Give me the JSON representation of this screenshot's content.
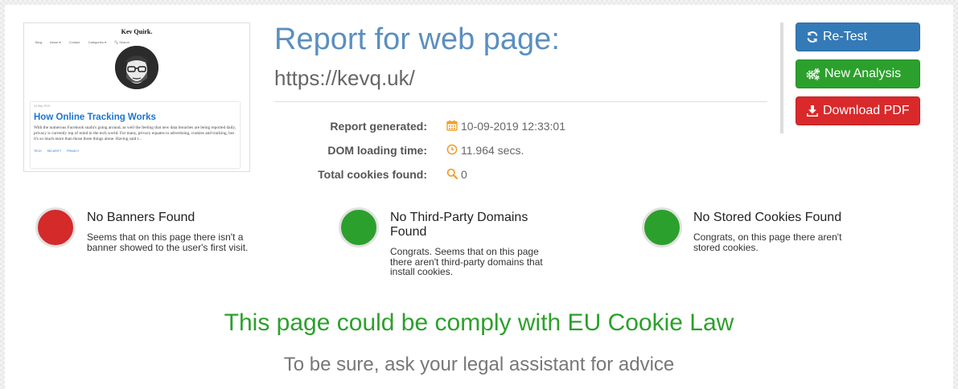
{
  "thumbnail": {
    "site_title": "Kev Quirk.",
    "nav": [
      "Blog",
      "About ▾",
      "Contact",
      "Categories ▾",
      "🔍 Search"
    ],
    "post_date": "10 Sep 2019",
    "post_title": "How Online Tracking Works",
    "post_text": "With the numerous Facebook snafu's going around, as well the feeling that new data breaches are being reported daily, privacy is currently top of mind in the tech world. For many, privacy equates to advertising, cookies and tracking, but it's so much more than those three things alone. Having said t...",
    "post_tags": [
      "TECH",
      "SECURITY",
      "PRIVACY"
    ]
  },
  "header": {
    "title": "Report for web page:",
    "url": "https://kevq.uk/"
  },
  "info": {
    "report_generated_label": "Report generated:",
    "report_generated_value": "10-09-2019 12:33:01",
    "dom_loading_label": "DOM loading time:",
    "dom_loading_value": "11.964 secs.",
    "cookies_label": "Total cookies found:",
    "cookies_value": "0"
  },
  "buttons": {
    "retest": "Re-Test",
    "new_analysis": "New Analysis",
    "download_pdf": "Download PDF"
  },
  "statuses": [
    {
      "title": "No Banners Found",
      "desc": "Seems that on this page there isn't a banner showed to the user's first visit.",
      "color": "#d42a2a"
    },
    {
      "title": "No Third-Party Domains Found",
      "desc": "Congrats. Seems that on this page there aren't third-party domains that install cookies.",
      "color": "#2ca02c"
    },
    {
      "title": "No Stored Cookies Found",
      "desc": "Congrats, on this page there aren't stored cookies.",
      "color": "#2ca02c"
    }
  ],
  "verdict": "This page could be comply with EU Cookie Law",
  "advice": "To be sure, ask your legal assistant for advice",
  "colors": {
    "title_blue": "#5b8fc0",
    "icon_orange": "#f0a030",
    "success_green": "#2ca02c",
    "danger_red": "#d42a2a",
    "primary_blue": "#337ab7"
  }
}
